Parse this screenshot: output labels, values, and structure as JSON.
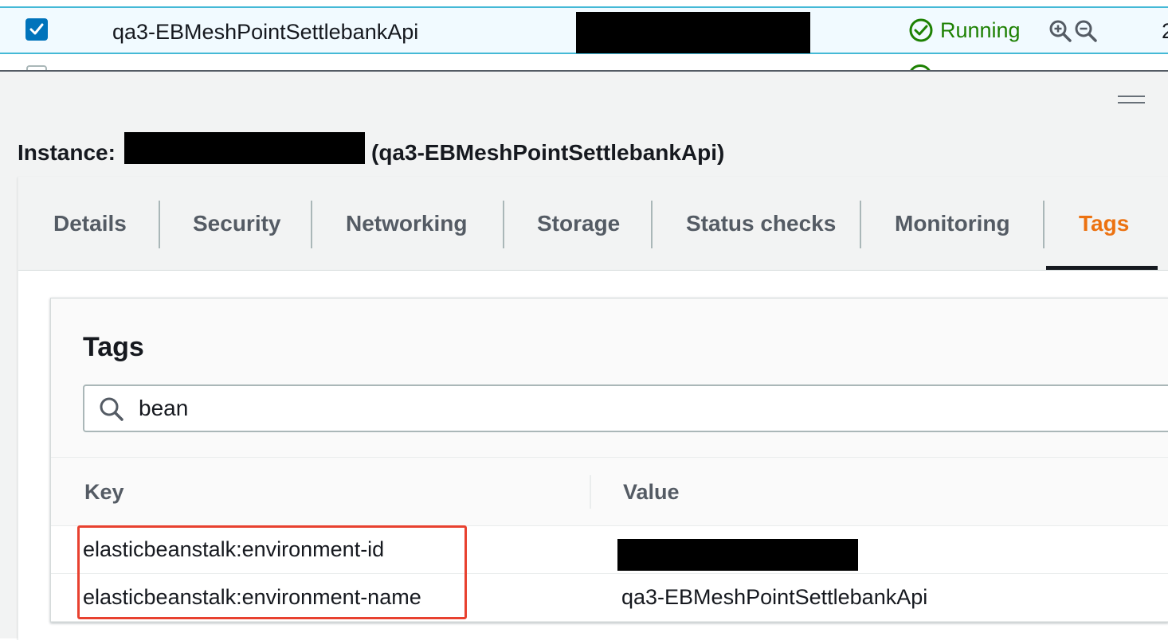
{
  "instance_row": {
    "checked": true,
    "name": "qa3-EBMeshPointSettlebankApi",
    "status": "Running",
    "status_color": "#1d8102",
    "trailing": "2",
    "icons": [
      "zoom-in-icon",
      "zoom-out-icon"
    ]
  },
  "instance_panel": {
    "title_prefix": "Instance:",
    "title_suffix": "(qa3-EBMeshPointSettlebankApi)"
  },
  "tabs": [
    {
      "label": "Details",
      "active": false
    },
    {
      "label": "Security",
      "active": false
    },
    {
      "label": "Networking",
      "active": false
    },
    {
      "label": "Storage",
      "active": false
    },
    {
      "label": "Status checks",
      "active": false
    },
    {
      "label": "Monitoring",
      "active": false
    },
    {
      "label": "Tags",
      "active": true
    }
  ],
  "tags": {
    "title": "Tags",
    "search_value": "bean",
    "columns": [
      "Key",
      "Value"
    ],
    "rows": [
      {
        "key": "elasticbeanstalk:environment-id",
        "value": ""
      },
      {
        "key": "elasticbeanstalk:environment-name",
        "value": "qa3-EBMeshPointSettlebankApi"
      }
    ]
  },
  "colors": {
    "accent_tab": "#ec7211",
    "highlight": "#e8412f",
    "selection": "#0073bb"
  }
}
